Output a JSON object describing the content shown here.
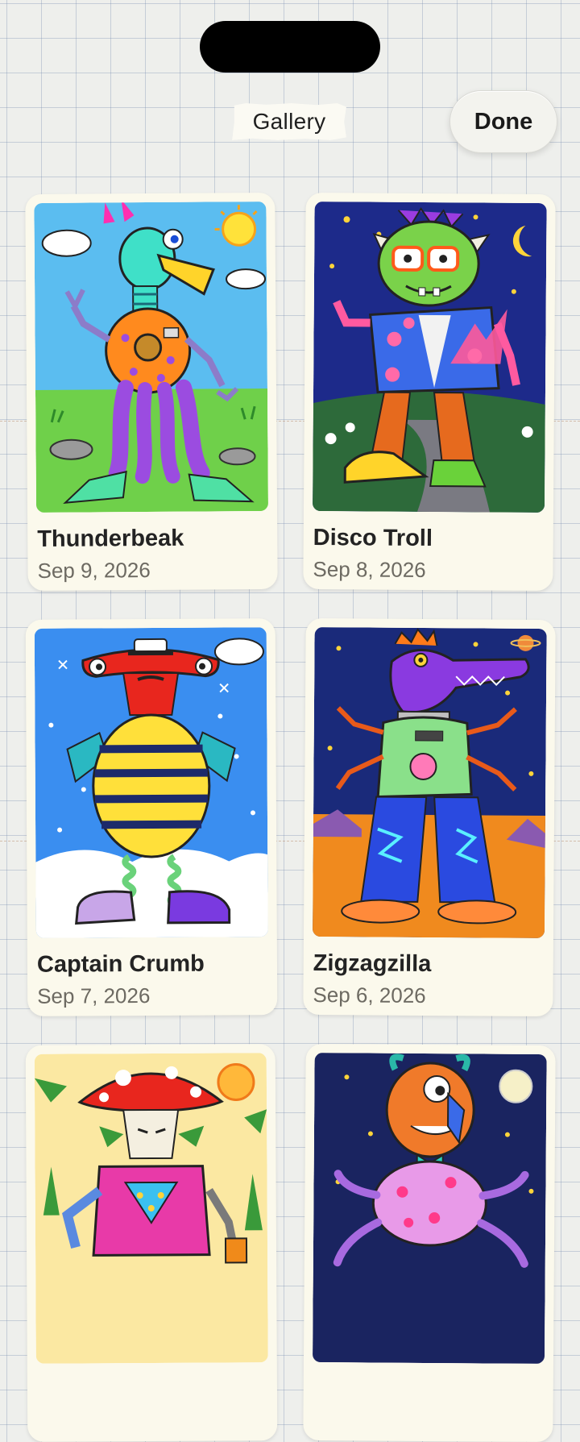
{
  "header": {
    "title": "Gallery",
    "done_label": "Done"
  },
  "gallery": {
    "items": [
      {
        "name": "Thunderbeak",
        "date": "Sep 9, 2026",
        "art": "bird-robot-monster-drawing"
      },
      {
        "name": "Disco Troll",
        "date": "Sep 8, 2026",
        "art": "green-troll-monster-drawing"
      },
      {
        "name": "Captain Crumb",
        "date": "Sep 7, 2026",
        "art": "hammerhead-bee-monster-drawing"
      },
      {
        "name": "Zigzagzilla",
        "date": "Sep 6, 2026",
        "art": "purple-croc-monster-drawing"
      },
      {
        "name": "",
        "date": "",
        "art": "mushroom-robot-monster-drawing"
      },
      {
        "name": "",
        "date": "",
        "art": "orange-octopus-monster-drawing"
      }
    ]
  },
  "colors": {
    "paper": "#eeefec",
    "grid": "#8c9ab4",
    "card": "#fbf9ec",
    "text": "#232323",
    "date_text": "#6d6a62"
  }
}
